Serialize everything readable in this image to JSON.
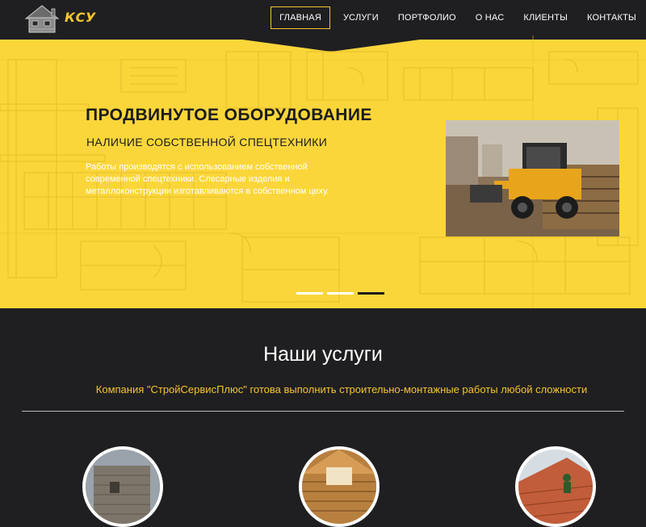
{
  "brand": {
    "logo_text": "КСУ"
  },
  "nav": {
    "items": [
      {
        "label": "Главная",
        "active": true
      },
      {
        "label": "Услуги",
        "active": false
      },
      {
        "label": "Портфолио",
        "active": false
      },
      {
        "label": "О нас",
        "active": false
      },
      {
        "label": "Клиенты",
        "active": false
      },
      {
        "label": "Контакты",
        "active": false
      }
    ]
  },
  "hero": {
    "title": "ПРОДВИНУТОЕ ОБОРУДОВАНИЕ",
    "subtitle": "НАЛИЧИЕ СОБСТВЕННОЙ СПЕЦТЕХНИКИ",
    "description": "Работы производятся с использованием собственной современной спецтехники. Слесарные изделия и металлоконструкции изготавливаются в собственном цеху.",
    "slides_total": 3,
    "active_slide": 3
  },
  "services": {
    "title": "Наши услуги",
    "description": "Компания \"СтройСервисПлюс\" готова выполнить строительно-монтажные работы любой сложности"
  },
  "colors": {
    "accent": "#f4c430",
    "hero_bg": "#fbd63a",
    "page_bg": "#1f1f21"
  }
}
